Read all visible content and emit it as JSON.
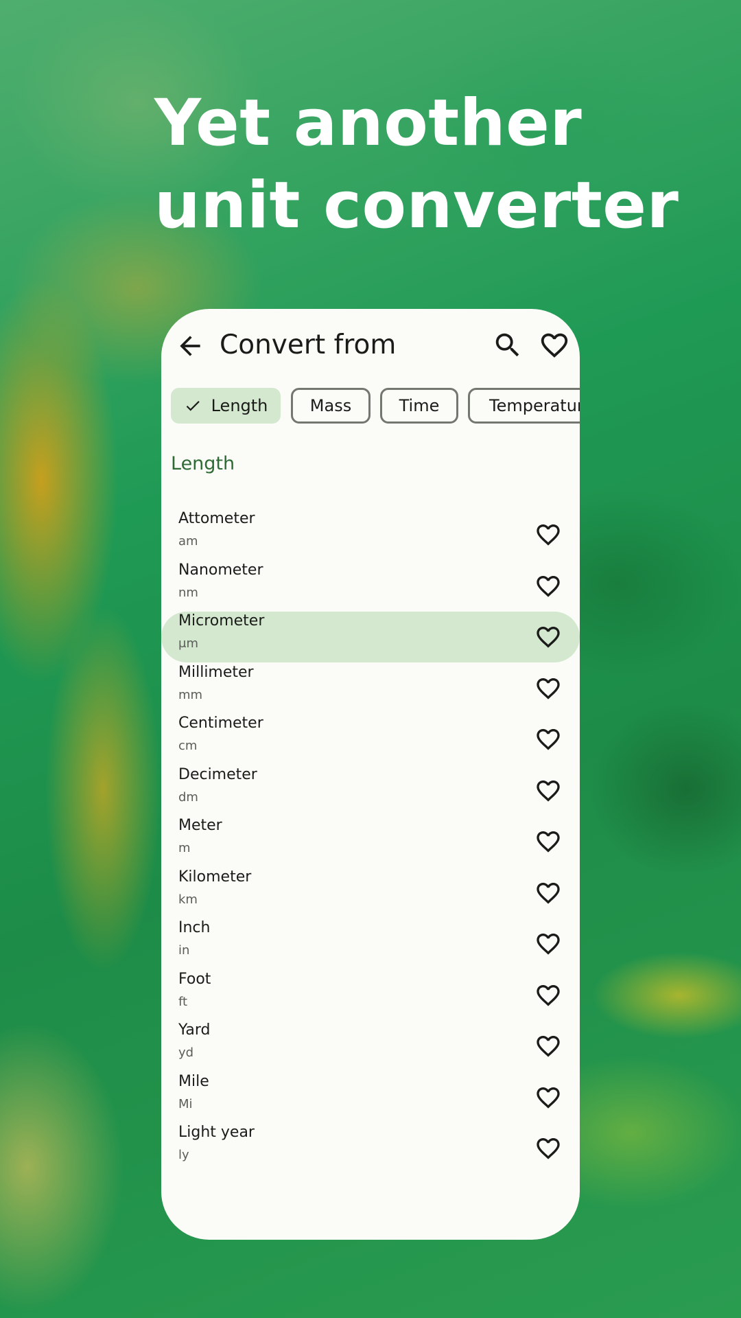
{
  "headline": {
    "line1": "Yet another",
    "line2": "unit converter"
  },
  "topbar": {
    "title": "Convert from"
  },
  "chips": [
    {
      "label": "Length",
      "selected": true
    },
    {
      "label": "Mass",
      "selected": false
    },
    {
      "label": "Time",
      "selected": false
    },
    {
      "label": "Temperature",
      "selected": false
    }
  ],
  "section_title": "Length",
  "units": [
    {
      "name": "Attometer",
      "symbol": "am",
      "selected": false
    },
    {
      "name": "Nanometer",
      "symbol": "nm",
      "selected": false
    },
    {
      "name": "Micrometer",
      "symbol": "μm",
      "selected": true
    },
    {
      "name": "Millimeter",
      "symbol": "mm",
      "selected": false
    },
    {
      "name": "Centimeter",
      "symbol": "cm",
      "selected": false
    },
    {
      "name": "Decimeter",
      "symbol": "dm",
      "selected": false
    },
    {
      "name": "Meter",
      "symbol": "m",
      "selected": false
    },
    {
      "name": "Kilometer",
      "symbol": "km",
      "selected": false
    },
    {
      "name": "Inch",
      "symbol": "in",
      "selected": false
    },
    {
      "name": "Foot",
      "symbol": "ft",
      "selected": false
    },
    {
      "name": "Yard",
      "symbol": "yd",
      "selected": false
    },
    {
      "name": "Mile",
      "symbol": "Mi",
      "selected": false
    },
    {
      "name": "Light year",
      "symbol": "ly",
      "selected": false
    }
  ],
  "colors": {
    "accent": "#2e6b34",
    "selected_bg": "#d3e8cf",
    "surface": "#fbfbf7"
  },
  "icons": {
    "back": "arrow-back-icon",
    "search": "search-icon",
    "favorite": "heart-outline-icon",
    "check": "check-icon"
  }
}
